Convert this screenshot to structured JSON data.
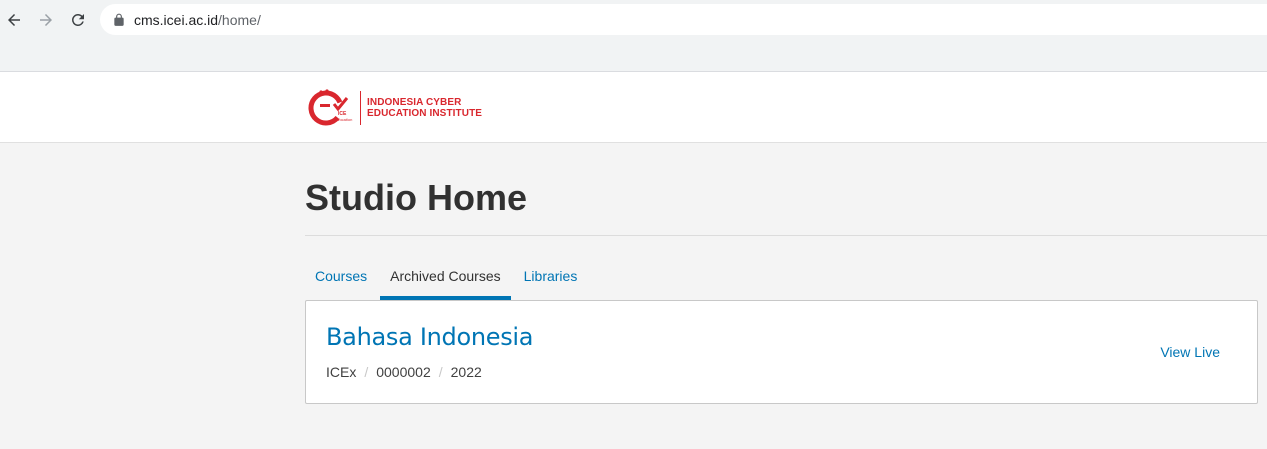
{
  "browser": {
    "url_host": "cms.icei.ac.id",
    "url_path": "/home/"
  },
  "header": {
    "logo_line1": "INDONESIA CYBER",
    "logo_line2": "EDUCATION INSTITUTE",
    "logo_mark_text": "ICE",
    "logo_mark_subtext": "Vocation"
  },
  "main": {
    "page_title": "Studio Home",
    "tabs": [
      {
        "label": "Courses",
        "active": false
      },
      {
        "label": "Archived Courses",
        "active": true
      },
      {
        "label": "Libraries",
        "active": false
      }
    ],
    "courses": [
      {
        "title": "Bahasa Indonesia",
        "org": "ICEx",
        "number": "0000002",
        "run": "2022",
        "view_live_label": "View Live"
      }
    ]
  },
  "colors": {
    "link_blue": "#0075b4",
    "brand_red": "#d9272e",
    "title_text": "#313131"
  }
}
